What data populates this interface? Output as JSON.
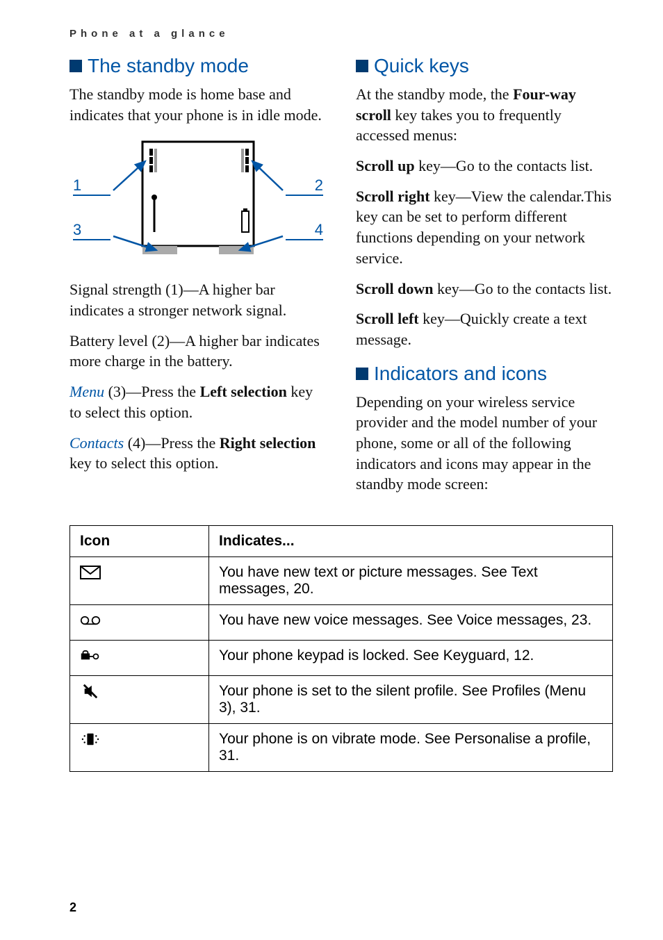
{
  "header": "Phone at a glance",
  "page_number": "2",
  "left": {
    "title": "The standby mode",
    "intro": "The standby mode is home base and indicates that your phone is in idle mode.",
    "diagram_labels": {
      "l1": "1",
      "l2": "2",
      "l3": "3",
      "l4": "4"
    },
    "p1": "Signal strength (1)—A higher bar indicates a stronger network signal.",
    "p2": "Battery level (2)—A higher bar indicates more charge in the battery.",
    "p3_accent": "Menu",
    "p3_rest_a": " (3)—Press the ",
    "p3_bold": "Left selection",
    "p3_rest_b": " key to select this option.",
    "p4_accent": "Contacts",
    "p4_rest_a": " (4)—Press the ",
    "p4_bold": "Right selection",
    "p4_rest_b": " key to select this option."
  },
  "right": {
    "title1": "Quick keys",
    "q_intro_a": "At the standby mode, the ",
    "q_intro_bold": "Four-way scroll",
    "q_intro_b": " key takes you to frequently accessed menus:",
    "q_up_bold": "Scroll up",
    "q_up_rest": " key—Go to the contacts list.",
    "q_right_bold": "Scroll right",
    "q_right_rest": " key—View the calendar.This key can be set to perform different functions depending on your network service.",
    "q_down_bold": "Scroll down",
    "q_down_rest": " key—Go to the contacts list.",
    "q_left_bold": "Scroll left",
    "q_left_rest": " key—Quickly create a text message.",
    "title2": "Indicators and icons",
    "ind_intro": "Depending on your wireless service provider and the model number of your phone, some or all of the following indicators and icons may appear in the standby mode screen:"
  },
  "table": {
    "h1": "Icon",
    "h2": "Indicates...",
    "rows": [
      {
        "icon": "envelope",
        "text": "You have new text or picture messages. See Text messages, 20."
      },
      {
        "icon": "voicemail",
        "text": "You have new voice messages. See Voice messages, 23."
      },
      {
        "icon": "lock-key",
        "text": "Your phone keypad is locked. See Keyguard, 12."
      },
      {
        "icon": "silent",
        "text": "Your phone is set to the silent profile. See Profiles (Menu 3), 31."
      },
      {
        "icon": "vibrate",
        "text": "Your phone is on vibrate mode. See Personalise a profile, 31."
      }
    ]
  }
}
